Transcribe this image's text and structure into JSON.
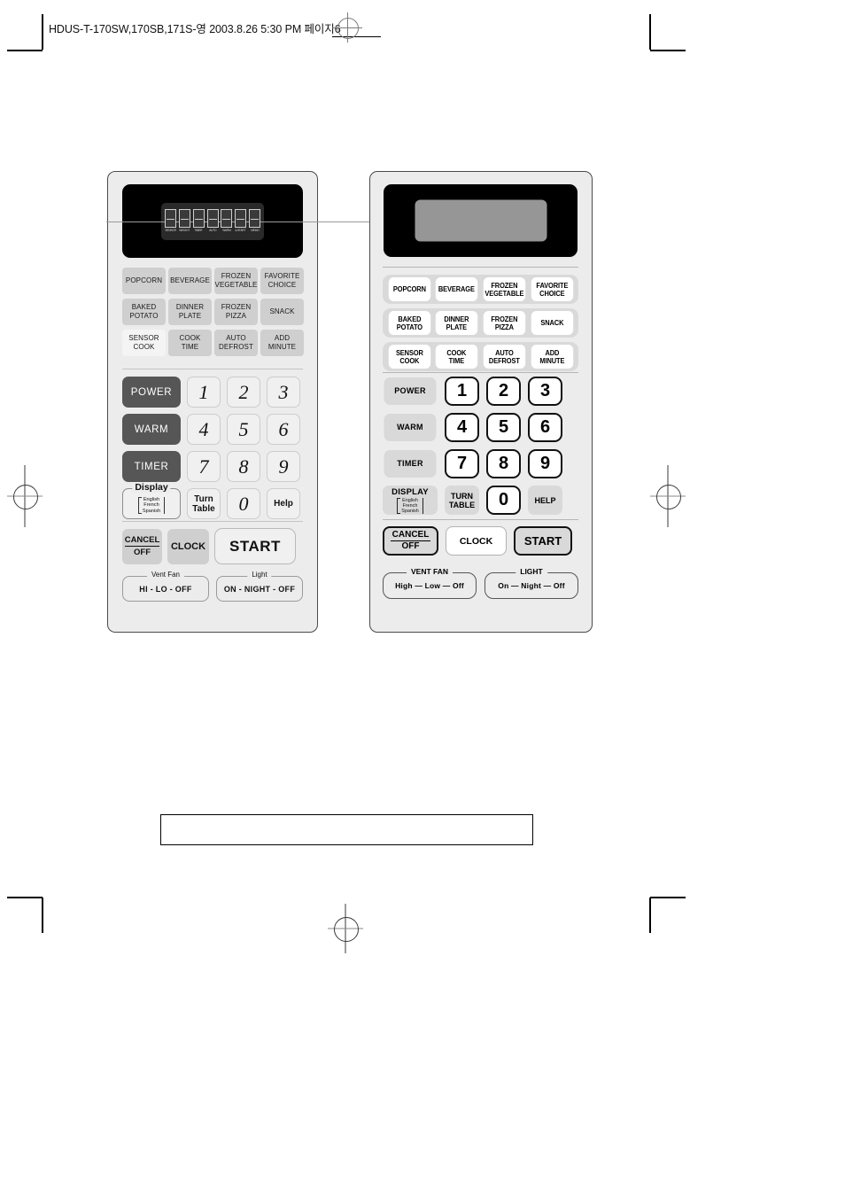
{
  "page": {
    "header_text": "HDUS-T-170SW,170SB,171S-영   2003.8.26 5:30 PM   페이지6",
    "caption_box_text": ""
  },
  "panels": [
    {
      "id": "left",
      "style_note": "shaded-render",
      "display": {
        "lcd_segments": [
          {
            "label": "SENSOR"
          },
          {
            "label": "WEIGHT"
          },
          {
            "label": "TIMER"
          },
          {
            "label": "AUTO"
          },
          {
            "label": "WARM"
          },
          {
            "label": "A.START"
          },
          {
            "label": "MEMO"
          }
        ]
      },
      "preset_rows": [
        [
          "POPCORN",
          "FROZEN\nVEGETABLE",
          "BEVERAGE",
          "FAVORITE\nCHOICE"
        ],
        [
          "BAKED\nPOTATO",
          "DINNER\nPLATE",
          "FROZEN\nPIZZA",
          "SNACK"
        ],
        [
          "SENSOR\nCOOK",
          "COOK\nTIME",
          "AUTO\nDEFROST",
          "ADD\nMINUTE"
        ]
      ],
      "presets": {
        "r1": [
          {
            "line1": "POPCORN",
            "line2": ""
          },
          {
            "line1": "BEVERAGE",
            "line2": ""
          },
          {
            "line1": "FROZEN",
            "line2": "VEGETABLE"
          },
          {
            "line1": "FAVORITE",
            "line2": "CHOICE"
          }
        ],
        "r2": [
          {
            "line1": "BAKED",
            "line2": "POTATO"
          },
          {
            "line1": "DINNER",
            "line2": "PLATE"
          },
          {
            "line1": "FROZEN",
            "line2": "PIZZA"
          },
          {
            "line1": "SNACK",
            "line2": ""
          }
        ],
        "r3": [
          {
            "line1": "SENSOR",
            "line2": "COOK"
          },
          {
            "line1": "COOK",
            "line2": "TIME"
          },
          {
            "line1": "AUTO",
            "line2": "DEFROST"
          },
          {
            "line1": "ADD",
            "line2": "MINUTE"
          }
        ]
      },
      "keypad": {
        "power": "POWER",
        "warm": "WARM",
        "timer": "TIMER",
        "display_caption": "Display",
        "languages": [
          "English",
          "French",
          "Spanish"
        ],
        "turn_table_l1": "Turn",
        "turn_table_l2": "Table",
        "help": "Help",
        "digits": [
          "1",
          "2",
          "3",
          "4",
          "5",
          "6",
          "7",
          "8",
          "9",
          "0"
        ]
      },
      "bottom": {
        "cancel_top": "CANCEL",
        "cancel_bottom": "OFF",
        "clock": "CLOCK",
        "start": "START",
        "vent_fan_caption": "Vent Fan",
        "vent_fan_value": "HI - LO - OFF",
        "light_caption": "Light",
        "light_value": "ON - NIGHT - OFF"
      }
    },
    {
      "id": "right",
      "style_note": "line-art-render",
      "presets": {
        "r1": [
          {
            "line1": "POPCORN",
            "line2": ""
          },
          {
            "line1": "BEVERAGE",
            "line2": ""
          },
          {
            "line1": "FROZEN",
            "line2": "VEGETABLE"
          },
          {
            "line1": "FAVORITE",
            "line2": "CHOICE"
          }
        ],
        "r2": [
          {
            "line1": "BAKED",
            "line2": "POTATO"
          },
          {
            "line1": "DINNER",
            "line2": "PLATE"
          },
          {
            "line1": "FROZEN",
            "line2": "PIZZA"
          },
          {
            "line1": "SNACK",
            "line2": ""
          }
        ],
        "r3": [
          {
            "line1": "SENSOR",
            "line2": "COOK"
          },
          {
            "line1": "COOK",
            "line2": "TIME"
          },
          {
            "line1": "AUTO",
            "line2": "DEFROST"
          },
          {
            "line1": "ADD",
            "line2": "MINUTE"
          }
        ]
      },
      "keypad": {
        "power": "POWER",
        "warm": "WARM",
        "timer": "TIMER",
        "display_caption": "DISPLAY",
        "languages": [
          "English",
          "French",
          "Spanish"
        ],
        "turn_table_l1": "TURN",
        "turn_table_l2": "TABLE",
        "help": "HELP",
        "digits": [
          "1",
          "2",
          "3",
          "4",
          "5",
          "6",
          "7",
          "8",
          "9",
          "0"
        ]
      },
      "bottom": {
        "cancel_top": "CANCEL",
        "cancel_bottom": "OFF",
        "clock": "CLOCK",
        "start": "START",
        "vent_fan_caption": "VENT FAN",
        "vent_fan_value": "High  —  Low  —  Off",
        "light_caption": "LIGHT",
        "light_value": "On  —  Night  —  Off"
      }
    }
  ],
  "colors": {
    "panel_bg": "#ececec",
    "panel_border": "#4a4a4a",
    "display_black": "#000000",
    "lcd_gray": "#969696",
    "button_gray": "#cfcfcf",
    "dark_button": "#565656",
    "strip_gray": "#d9d9d9",
    "text_black": "#111111"
  }
}
